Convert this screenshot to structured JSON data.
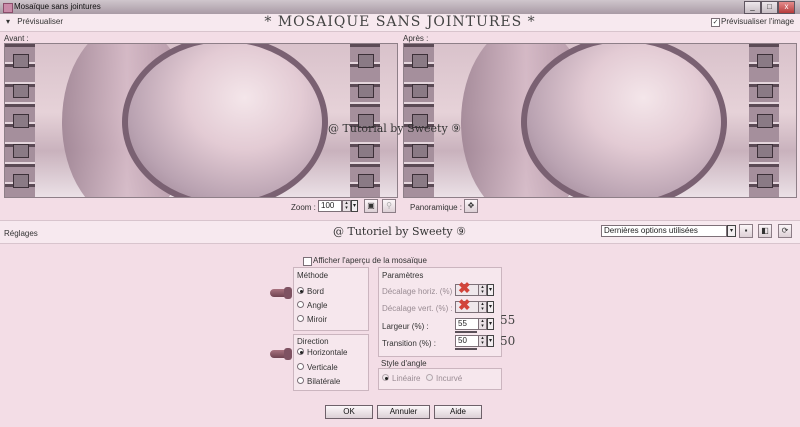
{
  "window": {
    "title": "Mosaïque sans jointures",
    "min_label": "_",
    "max_label": "□",
    "close_label": "x"
  },
  "header": {
    "preview_menu": "Prévisualiser",
    "plugin_title": "* MOSAIQUE SANS JOINTURES *",
    "preview_image_label": "Prévisualiser l'image",
    "preview_image_checked": "✓"
  },
  "preview": {
    "before_label": "Avant :",
    "after_label": "Après :",
    "watermark": "@ Tutorial by Sweety ⑨",
    "zoom_label": "Zoom :",
    "zoom_value": "100",
    "panoramic_label": "Panoramique :"
  },
  "settings": {
    "title": "Réglages",
    "watermark": "@ Tutoriel by Sweety ⑨",
    "presets_value": "Dernières options utilisées",
    "show_overview_label": "Afficher l'aperçu de la mosaïque",
    "method": {
      "label": "Méthode",
      "options": [
        "Bord",
        "Angle",
        "Miroir"
      ],
      "selected": "Bord"
    },
    "direction": {
      "label": "Direction",
      "options": [
        "Horizontale",
        "Verticale",
        "Bilatérale"
      ],
      "selected": "Horizontale"
    },
    "params": {
      "label": "Paramètres",
      "horiz_offset_label": "Décalage horiz. (%) :",
      "vert_offset_label": "Décalage vert. (%) :",
      "width_label": "Largeur (%) :",
      "width_value": "55",
      "width_note": "55",
      "transition_label": "Transition (%) :",
      "transition_value": "50",
      "transition_note": "50"
    },
    "corner_style": {
      "label": "Style d'angle",
      "options": [
        "Linéaire",
        "Incurvé"
      ],
      "selected": "Linéaire"
    }
  },
  "buttons": {
    "ok": "OK",
    "cancel": "Annuler",
    "help": "Aide"
  },
  "colors": {
    "background": "#f3dde6",
    "annotation_x": "#d2433a"
  }
}
